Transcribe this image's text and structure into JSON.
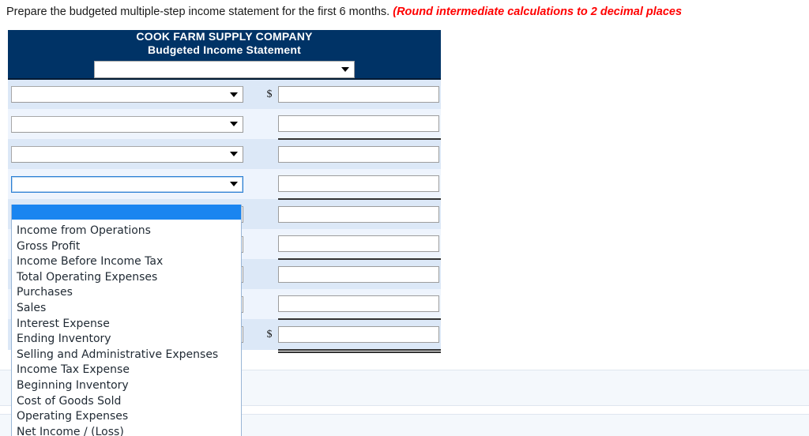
{
  "instruction": {
    "text": "Prepare the budgeted multiple-step income statement for the first 6 months. ",
    "emphasis": "(Round intermediate calculations to 2 decimal places"
  },
  "statement": {
    "company_name": "COOK FARM SUPPLY COMPANY",
    "statement_title": "Budgeted Income Statement",
    "period_select": {
      "name": "period-select",
      "value": "",
      "caret": "chevron-down-icon"
    },
    "rows": [
      {
        "label_select_value": "",
        "dollar": "$",
        "amount": "",
        "rule": "none"
      },
      {
        "label_select_value": "",
        "dollar": "",
        "amount": "",
        "rule": "single"
      },
      {
        "label_select_value": "",
        "dollar": "",
        "amount": "",
        "rule": "none"
      },
      {
        "label_select_value": "",
        "dollar": "",
        "amount": "",
        "rule": "single"
      },
      {
        "label_select_value": "",
        "dollar": "",
        "amount": "",
        "rule": "none"
      },
      {
        "label_select_value": "",
        "dollar": "",
        "amount": "",
        "rule": "single"
      },
      {
        "label_select_value": "",
        "dollar": "",
        "amount": "",
        "rule": "none"
      },
      {
        "label_select_value": "",
        "dollar": "",
        "amount": "",
        "rule": "single"
      },
      {
        "label_select_value": "",
        "dollar": "$",
        "amount": "",
        "rule": "double"
      }
    ],
    "amount_placeholder": ""
  },
  "open_dropdown": {
    "owner_row_index": 3,
    "selected_value": "",
    "options": [
      "",
      "Income from Operations",
      "Gross Profit",
      "Income Before Income Tax",
      "Total Operating Expenses",
      "Purchases",
      "Sales",
      "Interest Expense",
      "Ending Inventory",
      "Selling and Administrative Expenses",
      "Income Tax Expense",
      "Beginning Inventory",
      "Cost of Goods Sold",
      "Operating Expenses",
      "Net Income / (Loss)"
    ]
  },
  "colors": {
    "header_navy": "#003366",
    "row_band_a": "#dce8f7",
    "row_band_b": "#eef4fd",
    "highlight_blue": "#1a85f0",
    "alert_red": "#ff0000"
  }
}
